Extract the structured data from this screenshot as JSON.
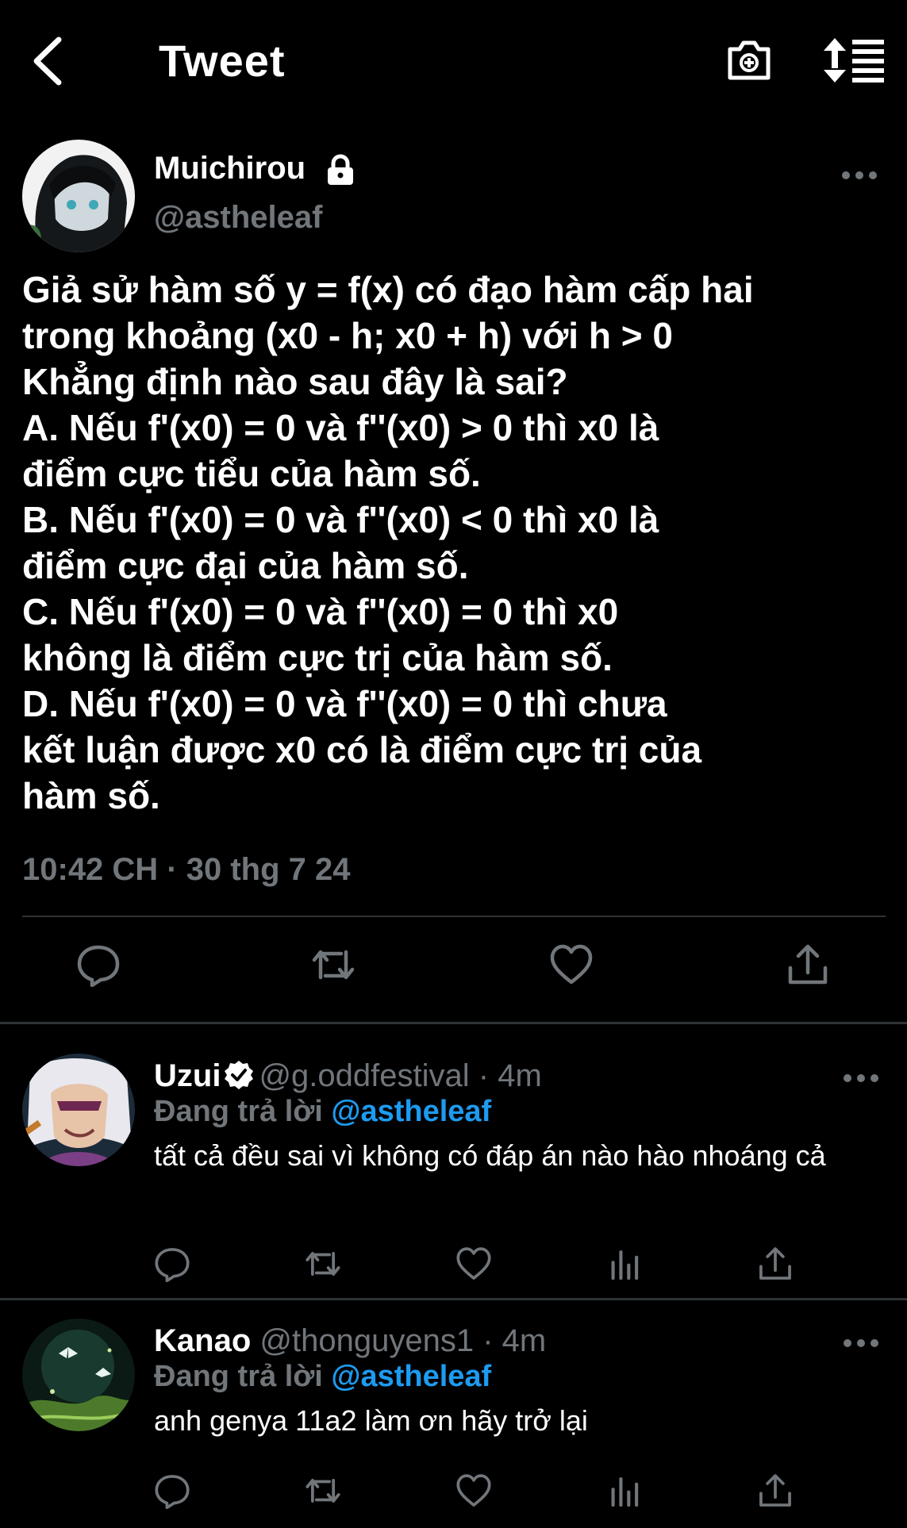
{
  "header": {
    "title": "Tweet",
    "back_icon": "chevron-left-icon",
    "camera_icon": "camera-add-icon",
    "sort_icon": "sort-icon"
  },
  "tweet": {
    "author_name": "Muichirou",
    "author_handle": "@astheleaf",
    "text": "Giả sử hàm số y = f(x) có đạo hàm cấp hai\ntrong khoảng (x0 - h; x0 + h) với h > 0\nKhẳng định nào sau đây là sai?\nA. Nếu f'(x0) = 0 và f''(x0) > 0 thì x0 là\nđiểm cực tiểu của hàm số.\nB. Nếu f'(x0) = 0 và f''(x0) < 0 thì x0 là\nđiểm cực đại của hàm số.\nC. Nếu f'(x0) = 0 và f''(x0) = 0 thì x0\nkhông là điểm cực trị của hàm số.\nD. Nếu f'(x0) = 0 và f''(x0) = 0 thì chưa\nkết luận được x0 có là điểm cực trị của\nhàm số.",
    "timestamp": "10:42 CH · 30 thg 7 24"
  },
  "replies": [
    {
      "name": "Uzui",
      "verified": true,
      "handle": "@g.oddfestival",
      "dot": "·",
      "time": "4m",
      "replying_prefix": "Đang trả lời",
      "replying_to": "@astheleaf",
      "text": "tất cả đều sai vì không có đáp án nào hào nhoáng cả"
    },
    {
      "name": "Kanao",
      "verified": false,
      "handle": "@thonguyens1",
      "dot": "·",
      "time": "4m",
      "replying_prefix": "Đang trả lời",
      "replying_to": "@astheleaf",
      "text": "anh genya 11a2 làm ơn hãy trở lại"
    }
  ],
  "colors": {
    "background": "#000000",
    "text": "#ffffff",
    "secondary": "#71767b",
    "accent": "#1d9bf0",
    "divider": "#2f3336"
  }
}
